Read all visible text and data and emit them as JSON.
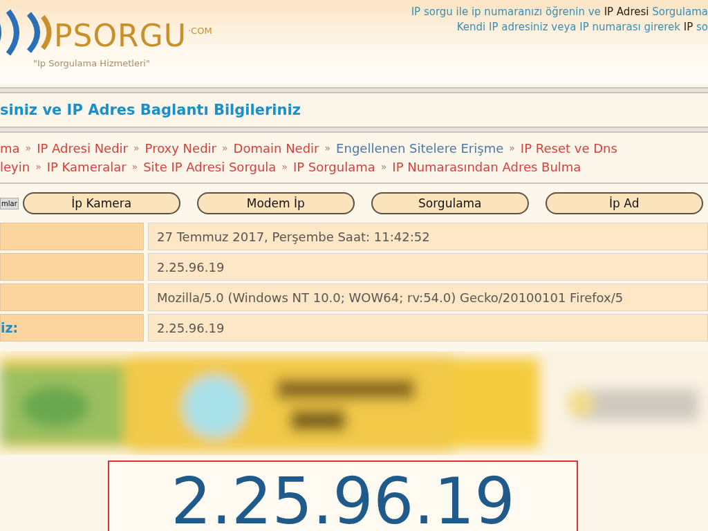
{
  "header": {
    "logo": {
      "name": "PSORGU",
      "suffix": "·COM",
      "tagline": "\"Ip Sorgulama Hizmetleri\""
    },
    "intro_lines": [
      "IP sorgu ile ip numaranızı öğrenin ve **IP Adresi** Sorgulama",
      "Kendi IP adresiniz veya IP numarası girerek **IP** so"
    ]
  },
  "section_title": "siniz ve IP Adres Baglantı Bilgileriniz",
  "nav": {
    "separator": "»",
    "lines": [
      [
        {
          "label": "ma",
          "color": "#d9403a"
        },
        {
          "label": "IP Adresi Nedir",
          "color": "#d9403a"
        },
        {
          "label": "Proxy Nedir",
          "color": "#d9403a"
        },
        {
          "label": "Domain Nedir",
          "color": "#d9403a"
        },
        {
          "label": "Engellenen Sitelere Erişme",
          "color": "#4a78a8"
        },
        {
          "label": "IP Reset ve Dns",
          "color": "#d9403a"
        }
      ],
      [
        {
          "label": "leyin",
          "color": "#d9403a"
        },
        {
          "label": "IP Kameralar",
          "color": "#d9403a"
        },
        {
          "label": "Site IP Adresi Sorgula",
          "color": "#d9403a"
        },
        {
          "label": "IP Sorgulama",
          "color": "#d9403a"
        },
        {
          "label": "IP Numarasından Adres Bulma",
          "color": "#d9403a"
        }
      ]
    ]
  },
  "buttons": [
    {
      "label": "mlar",
      "kind": "small"
    },
    {
      "label": "İp Kamera",
      "kind": "pill"
    },
    {
      "label": "Modem İp",
      "kind": "pill"
    },
    {
      "label": "Sorgulama",
      "kind": "pill"
    },
    {
      "label": "İp Ad",
      "kind": "pill"
    }
  ],
  "info_rows": [
    {
      "value": "27 Temmuz 2017, Perşembe Saat: 11:42:52"
    },
    {
      "value": "2.25.96.19"
    },
    {
      "value": "Mozilla/5.0 (Windows NT 10.0; WOW64; rv:54.0) Gecko/20100101 Firefox/5"
    },
    {
      "label": "iz:",
      "value": "2.25.96.19"
    }
  ],
  "ip_display": "2.25.96.19"
}
